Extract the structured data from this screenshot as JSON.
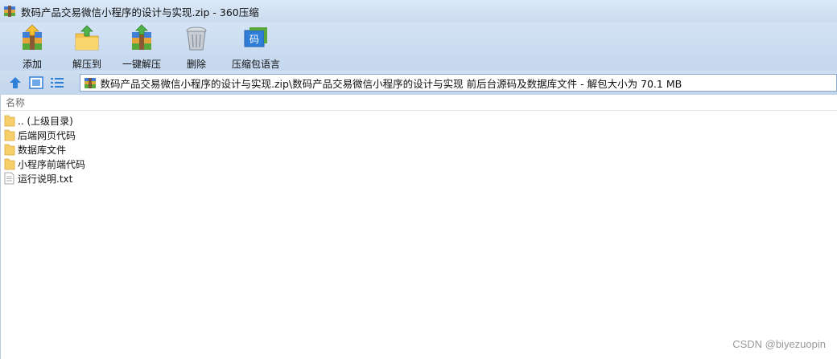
{
  "window": {
    "title": "数码产品交易微信小程序的设计与实现.zip - 360压缩",
    "app_icon": "archive-icon"
  },
  "toolbar": {
    "items": [
      {
        "label": "添加",
        "icon": "add-archive-icon"
      },
      {
        "label": "解压到",
        "icon": "extract-to-icon"
      },
      {
        "label": "一键解压",
        "icon": "one-click-extract-icon"
      },
      {
        "label": "删除",
        "icon": "trash-icon"
      },
      {
        "label": "压缩包语言",
        "icon": "archive-language-icon"
      }
    ],
    "language_icon_glyph": "码"
  },
  "navbar": {
    "path": "数码产品交易微信小程序的设计与实现.zip\\数码产品交易微信小程序的设计与实现 前后台源码及数据库文件 - 解包大小为 70.1 MB"
  },
  "list": {
    "column_name": "名称",
    "items": [
      {
        "name": ".. (上级目录)",
        "type": "folder"
      },
      {
        "name": "后端网页代码",
        "type": "folder"
      },
      {
        "name": "数据库文件",
        "type": "folder"
      },
      {
        "name": "小程序前端代码",
        "type": "folder"
      },
      {
        "name": "运行说明.txt",
        "type": "file"
      }
    ]
  },
  "watermark": "CSDN @biyezuopin",
  "colors": {
    "toolbar_bg": "#c9dbf0",
    "folder": "#f7cf6a",
    "accent_blue": "#2f7fd6"
  }
}
